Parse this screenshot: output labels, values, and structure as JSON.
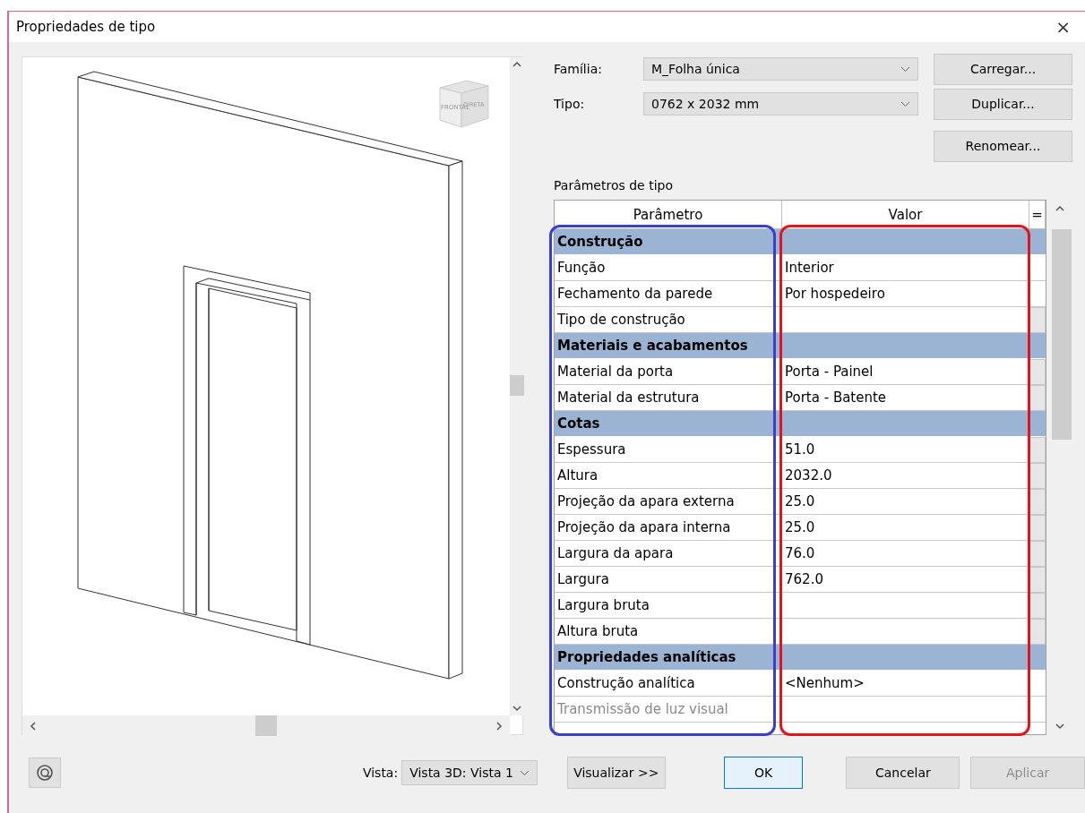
{
  "window": {
    "title": "Propriedades de tipo",
    "close": "×"
  },
  "preview": {
    "viewcube": {
      "front": "FRONTAL",
      "right": "DIRETA"
    }
  },
  "family": {
    "label": "Família:",
    "value": "M_Folha única"
  },
  "type": {
    "label": "Tipo:",
    "value": "0762 x 2032  mm"
  },
  "side_buttons": [
    "Carregar...",
    "Duplicar...",
    "Renomear..."
  ],
  "type_parameters": {
    "title": "Parâmetros de tipo",
    "columns": [
      "Parâmetro",
      "Valor",
      "="
    ],
    "rows": [
      {
        "kind": "group",
        "name": "Construção"
      },
      {
        "kind": "param",
        "name": "Função",
        "value": "Interior",
        "linkable": false,
        "disabled": false
      },
      {
        "kind": "param",
        "name": "Fechamento da parede",
        "value": "Por hospedeiro",
        "linkable": false,
        "disabled": false
      },
      {
        "kind": "param",
        "name": "Tipo de construção",
        "linkable": true,
        "disabled": false
      },
      {
        "kind": "group",
        "name": "Materiais e acabamentos"
      },
      {
        "kind": "param",
        "name": "Material da porta",
        "value": "Porta - Painel",
        "linkable": true,
        "disabled": false
      },
      {
        "kind": "param",
        "name": "Material da estrutura",
        "value": "Porta - Batente",
        "linkable": true,
        "disabled": false
      },
      {
        "kind": "group",
        "name": "Cotas"
      },
      {
        "kind": "param",
        "name": "Espessura",
        "value": "51.0",
        "linkable": true,
        "disabled": false
      },
      {
        "kind": "param",
        "name": "Altura",
        "value": "2032.0",
        "linkable": true,
        "disabled": false
      },
      {
        "kind": "param",
        "name": "Projeção da apara externa",
        "value": "25.0",
        "linkable": true,
        "disabled": false
      },
      {
        "kind": "param",
        "name": "Projeção da apara interna",
        "value": "25.0",
        "linkable": true,
        "disabled": false
      },
      {
        "kind": "param",
        "name": "Largura da apara",
        "value": "76.0",
        "linkable": true,
        "disabled": false
      },
      {
        "kind": "param",
        "name": "Largura",
        "value": "762.0",
        "linkable": true,
        "disabled": false
      },
      {
        "kind": "param",
        "name": "Largura bruta",
        "linkable": true,
        "disabled": false
      },
      {
        "kind": "param",
        "name": "Altura bruta",
        "linkable": true,
        "disabled": false
      },
      {
        "kind": "group",
        "name": "Propriedades analíticas"
      },
      {
        "kind": "param",
        "name": "Construção analítica",
        "value": "<Nenhum>",
        "linkable": false,
        "disabled": false
      },
      {
        "kind": "param",
        "name": "Transmissão de luz visual",
        "linkable": false,
        "disabled": true
      }
    ],
    "annotations": [
      {
        "color": "#3b3fc8"
      },
      {
        "color": "#e3141e"
      }
    ]
  },
  "view": {
    "label": "Vista:",
    "value": "Vista 3D: Vista 1"
  },
  "footer_buttons": [
    {
      "label": "Visualizar >>",
      "kind": "normal"
    },
    {
      "label": "OK",
      "kind": "default"
    },
    {
      "label": "Cancelar",
      "kind": "normal"
    },
    {
      "label": "Aplicar",
      "kind": "disabled"
    }
  ]
}
